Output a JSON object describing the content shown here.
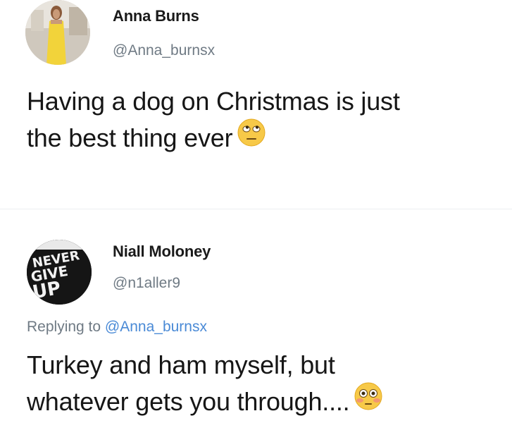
{
  "tweets": [
    {
      "display_name": "Anna Burns",
      "handle": "@Anna_burnsx",
      "line1": "Having a dog on Christmas is just",
      "line2": "the best thing ever",
      "emoji": "face-with-rolling-eyes-icon"
    },
    {
      "display_name": "Niall Moloney",
      "handle": "@n1aller9",
      "replying_prefix": "Replying to",
      "replying_to": "@Anna_burnsx",
      "line1": "Turkey and ham myself, but",
      "line2": "whatever gets you through....",
      "emoji": "flushed-face-icon",
      "avatar_text": [
        "NEVER",
        "GIVE",
        "UP"
      ]
    }
  ],
  "colors": {
    "secondary_text": "#6f7a84",
    "mention": "#4a8ad6",
    "emoji_yellow": "#f7c948"
  }
}
